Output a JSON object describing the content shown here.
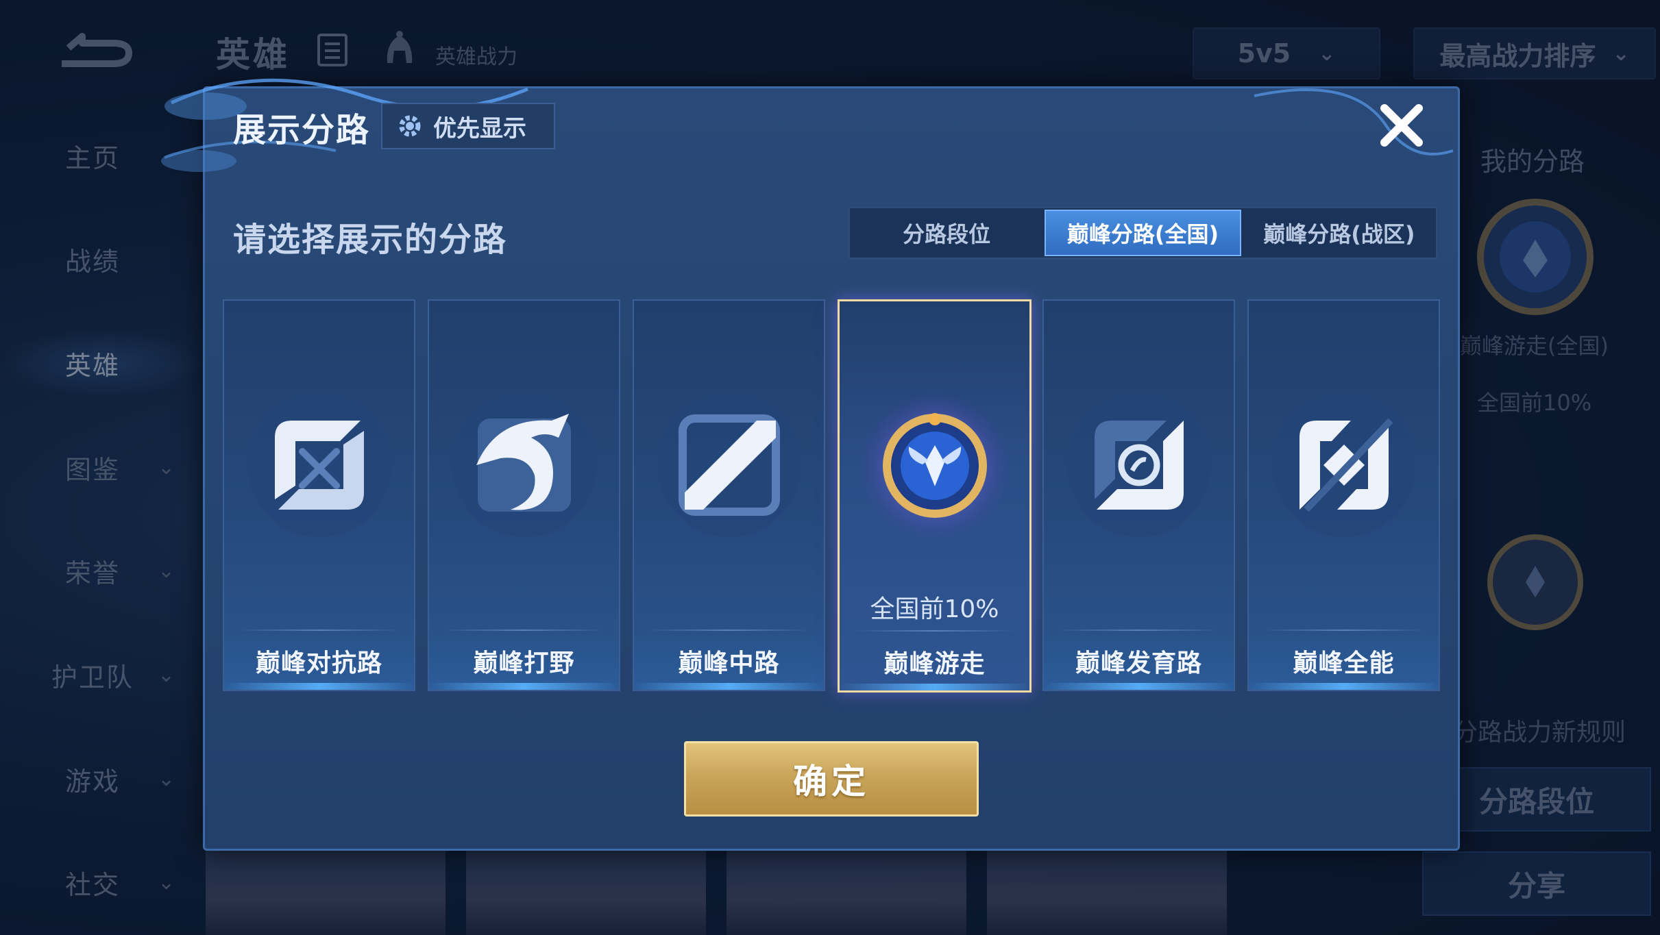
{
  "background": {
    "sidebar": {
      "items": [
        {
          "label": "主页"
        },
        {
          "label": "战绩"
        },
        {
          "label": "英雄"
        },
        {
          "label": "图鉴"
        },
        {
          "label": "荣誉"
        },
        {
          "label": "护卫队"
        },
        {
          "label": "游戏"
        },
        {
          "label": "社交"
        }
      ],
      "active": "英雄"
    },
    "topbar": {
      "title": "英雄",
      "subtitle": "英雄战力",
      "mode_select": "5v5",
      "sort_select": "最高战力排序"
    },
    "right_panel": {
      "title": "我的分路",
      "badge_label": "巅峰游走(全国)",
      "badge_rank": "全国前10%",
      "rule_text": "分路战力新规则",
      "rank_button": "分路段位",
      "share_button": "分享"
    }
  },
  "modal": {
    "title": "展示分路",
    "priority_button": "优先显示",
    "subtitle": "请选择展示的分路",
    "tabs": [
      {
        "label": "分路段位",
        "active": false
      },
      {
        "label": "巅峰分路(全国)",
        "active": true
      },
      {
        "label": "巅峰分路(战区)",
        "active": false
      }
    ],
    "cards": [
      {
        "name": "巅峰对抗路",
        "icon": "sword-lane-icon",
        "selected": false,
        "rank": ""
      },
      {
        "name": "巅峰打野",
        "icon": "dragon-jungle-icon",
        "selected": false,
        "rank": ""
      },
      {
        "name": "巅峰中路",
        "icon": "mid-lane-icon",
        "selected": false,
        "rank": ""
      },
      {
        "name": "巅峰游走",
        "icon": "winged-emblem-icon",
        "selected": true,
        "rank": "全国前10%"
      },
      {
        "name": "巅峰发育路",
        "icon": "marksman-lane-icon",
        "selected": false,
        "rank": ""
      },
      {
        "name": "巅峰全能",
        "icon": "all-round-icon",
        "selected": false,
        "rank": ""
      }
    ],
    "confirm_button": "确定"
  },
  "colors": {
    "accent_blue": "#3f86dc",
    "gold": "#cfa95d",
    "selected_border": "#f1d9a0"
  }
}
